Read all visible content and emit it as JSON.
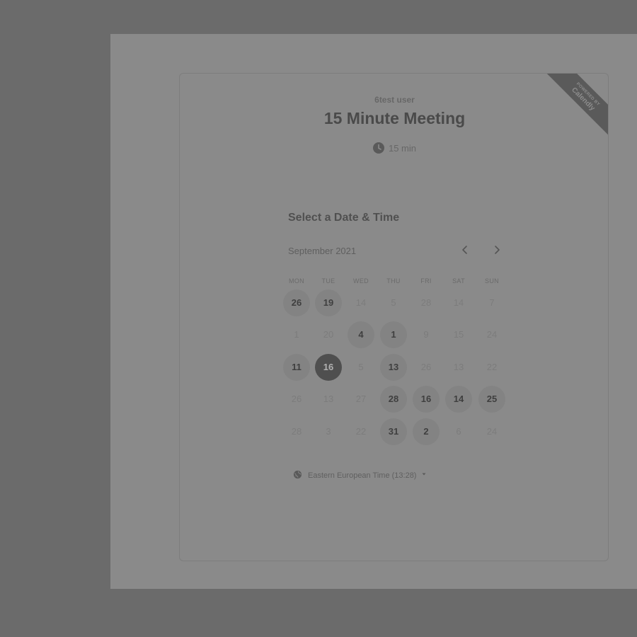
{
  "header": {
    "host_name": "6test user",
    "event_title": "15 Minute Meeting",
    "duration": "15 min"
  },
  "ribbon": {
    "line1": "POWERED BY",
    "line2": "Calendly"
  },
  "calendar": {
    "section_title": "Select a Date & Time",
    "month": "September 2021",
    "prev_icon": "chevron-left-icon",
    "next_icon": "chevron-right-icon",
    "weekdays": [
      "MON",
      "TUE",
      "WED",
      "THU",
      "FRI",
      "SAT",
      "SUN"
    ],
    "weeks": [
      [
        {
          "label": "26",
          "state": "available"
        },
        {
          "label": "19",
          "state": "available"
        },
        {
          "label": "14",
          "state": "disabled"
        },
        {
          "label": "5",
          "state": "disabled"
        },
        {
          "label": "28",
          "state": "disabled"
        },
        {
          "label": "14",
          "state": "disabled"
        },
        {
          "label": "7",
          "state": "disabled"
        }
      ],
      [
        {
          "label": "1",
          "state": "disabled"
        },
        {
          "label": "20",
          "state": "disabled"
        },
        {
          "label": "4",
          "state": "available"
        },
        {
          "label": "1",
          "state": "available"
        },
        {
          "label": "9",
          "state": "disabled"
        },
        {
          "label": "15",
          "state": "disabled"
        },
        {
          "label": "24",
          "state": "disabled"
        }
      ],
      [
        {
          "label": "11",
          "state": "available"
        },
        {
          "label": "16",
          "state": "selected"
        },
        {
          "label": "5",
          "state": "disabled"
        },
        {
          "label": "13",
          "state": "available"
        },
        {
          "label": "26",
          "state": "disabled"
        },
        {
          "label": "13",
          "state": "disabled"
        },
        {
          "label": "22",
          "state": "disabled"
        }
      ],
      [
        {
          "label": "26",
          "state": "disabled"
        },
        {
          "label": "13",
          "state": "disabled"
        },
        {
          "label": "27",
          "state": "disabled"
        },
        {
          "label": "28",
          "state": "available"
        },
        {
          "label": "16",
          "state": "available"
        },
        {
          "label": "14",
          "state": "available"
        },
        {
          "label": "25",
          "state": "available"
        }
      ],
      [
        {
          "label": "28",
          "state": "disabled"
        },
        {
          "label": "3",
          "state": "disabled"
        },
        {
          "label": "22",
          "state": "disabled"
        },
        {
          "label": "31",
          "state": "available"
        },
        {
          "label": "2",
          "state": "available"
        },
        {
          "label": "6",
          "state": "disabled"
        },
        {
          "label": "24",
          "state": "disabled"
        }
      ]
    ]
  },
  "timezone": {
    "label": "Eastern European Time (13:28)",
    "icon": "globe-icon",
    "dropdown_icon": "caret-down-icon"
  },
  "colors": {
    "backdrop": "#6b6b6b",
    "panel": "#8a8a8a",
    "selected_day": "#4f4f4f",
    "available_day": "#838383"
  }
}
